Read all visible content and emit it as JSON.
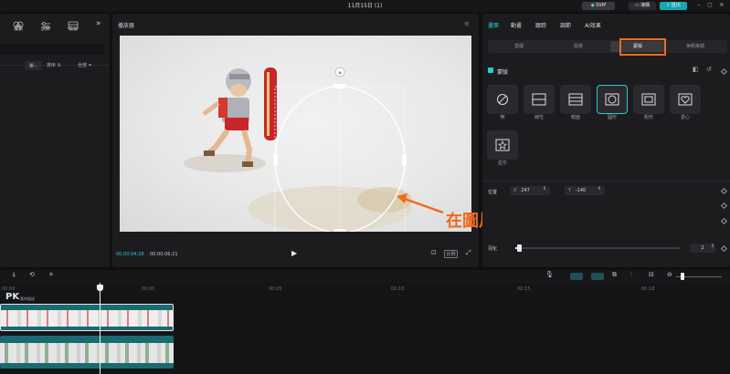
{
  "window": {
    "title": "11月15日 (1)",
    "svip_label": "SVIP",
    "member_label": "導購",
    "export_label": "匯出"
  },
  "left_toolbar": [
    {
      "label": "濾鏡",
      "icon": "filter-icon"
    },
    {
      "label": "調節",
      "icon": "adjust-icon"
    },
    {
      "label": "模板",
      "icon": "template-icon"
    }
  ],
  "left_filters": {
    "sort_label": "排序",
    "all_label": "全部"
  },
  "player": {
    "title": "播放器",
    "current_time": "00:00:04:28",
    "total_time": "00:00:06:21",
    "ratio_label": "比例"
  },
  "inspector": {
    "tabs": [
      "畫面",
      "動畫",
      "跟踪",
      "調節",
      "AI效果"
    ],
    "active_tab": 0,
    "subtabs": [
      "基礎",
      "摳像",
      "蒙版",
      "美顏美體"
    ],
    "active_subtab": 2,
    "section_label": "蒙版",
    "masks": [
      {
        "label": "無",
        "icon": "none-mask-icon"
      },
      {
        "label": "線性",
        "icon": "linear-mask-icon"
      },
      {
        "label": "鏡面",
        "icon": "mirror-mask-icon"
      },
      {
        "label": "圓形",
        "icon": "circle-mask-icon"
      },
      {
        "label": "矩形",
        "icon": "rectangle-mask-icon"
      },
      {
        "label": "愛心",
        "icon": "heart-mask-icon"
      },
      {
        "label": "星形",
        "icon": "star-mask-icon"
      }
    ],
    "selected_mask": 3,
    "position_label": "位置",
    "pos_x_label": "X",
    "pos_x": "247",
    "pos_y_label": "Y",
    "pos_y": "-140",
    "feather_label": "羽化",
    "feather_value": "2",
    "feather_fraction": 0.02
  },
  "annotation": {
    "text": "在圖片層加入蒙版",
    "color": "#f06a1e"
  },
  "timeline": {
    "ruler": [
      "00:00",
      "00:05",
      "00:10",
      "00:15",
      "00:15",
      "00:18"
    ],
    "track_label": "PK",
    "track_sublabel": "素材描述"
  },
  "colors": {
    "accent": "#25d0c9",
    "export": "#1aa6b0",
    "clip": "#1a6b70",
    "annotation_box": "#f06a1e"
  }
}
